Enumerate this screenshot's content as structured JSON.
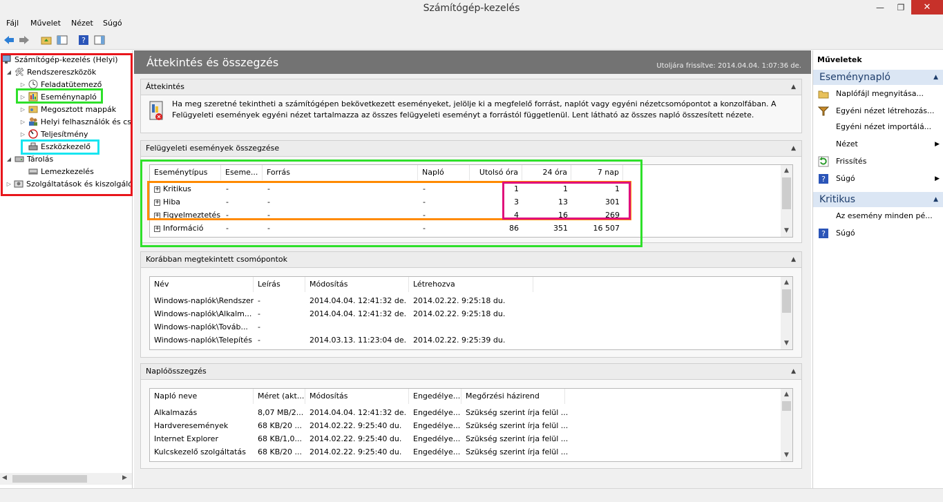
{
  "window": {
    "title": "Számítógép-kezelés",
    "minimize": "—",
    "restore": "❐",
    "close": "✕"
  },
  "menu": [
    "Fájl",
    "Művelet",
    "Nézet",
    "Súgó"
  ],
  "tree": {
    "root": "Számítógép-kezelés (Helyi)",
    "system_tools": "Rendszereszközök",
    "task_scheduler": "Feladatütemező",
    "event_viewer": "Eseménynapló",
    "shared_folders": "Megosztott mappák",
    "local_users": "Helyi felhasználók és cs",
    "performance": "Teljesítmény",
    "device_manager": "Eszközkezelő",
    "storage": "Tárolás",
    "disk_management": "Lemezkezelés",
    "services": "Szolgáltatások és kiszolgáló"
  },
  "center": {
    "title": "Áttekintés és összegzés",
    "refreshed": "Utoljára frissítve: 2014.04.04. 1:07:36 de.",
    "overview": {
      "header": "Áttekintés",
      "text": "Ha meg szeretné tekintheti a számítógépen bekövetkezett eseményeket, jelölje ki a megfelelő forrást, naplót vagy egyéni nézetcsomópontot a konzolfában. A Felügyeleti események egyéni nézet tartalmazza az összes felügyeleti eseményt a forrástól függetlenül. Lent látható az összes napló összesített nézete."
    },
    "admin_events": {
      "header": "Felügyeleti események összegzése",
      "columns": [
        "Eseménytípus",
        "Eseme...",
        "Forrás",
        "Napló",
        "Utolsó óra",
        "24 óra",
        "7 nap"
      ],
      "rows": [
        [
          "Kritikus",
          "-",
          "-",
          "-",
          "1",
          "1",
          "1"
        ],
        [
          "Hiba",
          "-",
          "-",
          "-",
          "3",
          "13",
          "301"
        ],
        [
          "Figyelmeztetés",
          "-",
          "-",
          "-",
          "4",
          "16",
          "269"
        ],
        [
          "Információ",
          "-",
          "-",
          "-",
          "86",
          "351",
          "16 507"
        ]
      ]
    },
    "recent_nodes": {
      "header": "Korábban megtekintett csomópontok",
      "columns": [
        "Név",
        "Leírás",
        "Módosítás",
        "Létrehozva"
      ],
      "rows": [
        [
          "Windows-naplók\\Rendszer",
          "-",
          "2014.04.04. 12:41:32 de.",
          "2014.02.22. 9:25:18 du."
        ],
        [
          "Windows-naplók\\Alkalm...",
          "-",
          "2014.04.04. 12:41:32 de.",
          "2014.02.22. 9:25:18 du."
        ],
        [
          "Windows-naplók\\Továb...",
          "-",
          "",
          ""
        ],
        [
          "Windows-naplók\\Telepítés",
          "-",
          "2014.03.13. 11:23:04 de.",
          "2014.02.22. 9:25:39 du."
        ]
      ]
    },
    "log_summary": {
      "header": "Naplóösszegzés",
      "columns": [
        "Napló neve",
        "Méret (akt...",
        "Módosítás",
        "Engedélye...",
        "Megőrzési házirend"
      ],
      "rows": [
        [
          "Alkalmazás",
          "8,07 MB/2...",
          "2014.04.04. 12:41:32 de.",
          "Engedélye...",
          "Szükség szerint írja felül ..."
        ],
        [
          "Hardveresemények",
          "68 KB/20 ...",
          "2014.02.22. 9:25:40 du.",
          "Engedélye...",
          "Szükség szerint írja felül ..."
        ],
        [
          "Internet Explorer",
          "68 KB/1,0...",
          "2014.02.22. 9:25:40 du.",
          "Engedélye...",
          "Szükség szerint írja felül ..."
        ],
        [
          "Kulcskezelő szolgáltatás",
          "68 KB/20 ...",
          "2014.02.22. 9:25:40 du.",
          "Engedélye...",
          "Szükség szerint írja felül ..."
        ]
      ]
    }
  },
  "actions": {
    "title": "Műveletek",
    "section1": "Eseménynapló",
    "items1": [
      "Naplófájl megnyitása...",
      "Egyéni nézet létrehozás...",
      "Egyéni nézet importálá...",
      "Nézet",
      "Frissítés",
      "Súgó"
    ],
    "section2": "Kritikus",
    "items2": [
      "Az esemény minden pé...",
      "Súgó"
    ]
  },
  "colors": {
    "red": "#e8151b",
    "green": "#2ee02a",
    "cyan": "#17e5f0",
    "orange": "#ff8a00",
    "magenta": "#e0107a",
    "banner": "#737373"
  }
}
